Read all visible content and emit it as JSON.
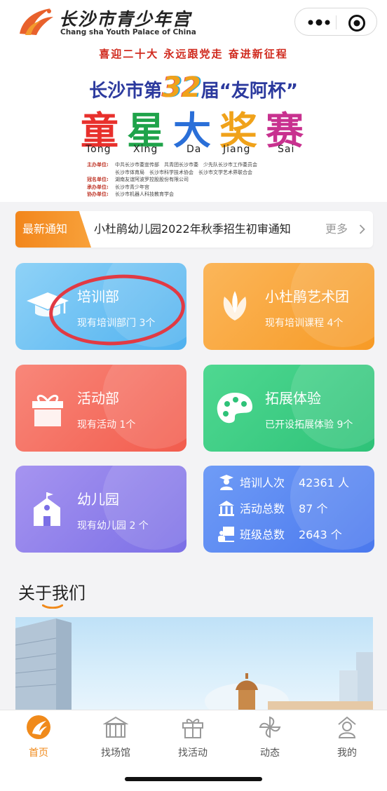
{
  "header": {
    "brand_cn": "长沙市青少年宫",
    "brand_en": "Chang sha Youth Palace of China"
  },
  "banner": {
    "slogan": "喜迎二十大 永远跟党走 奋进新征程",
    "subtitle_pre": "长沙市第",
    "subtitle_num": "32",
    "subtitle_post": "届“友阿杯”",
    "title_chars": [
      {
        "char": "童",
        "color": "#e8302c"
      },
      {
        "char": "星",
        "color": "#1fa34a"
      },
      {
        "char": "大",
        "color": "#2a6fd8"
      },
      {
        "char": "奖",
        "color": "#f0a21a"
      },
      {
        "char": "赛",
        "color": "#c8318f"
      }
    ],
    "pinyin": [
      "Tong",
      "Xing",
      "Da",
      "Jiang",
      "Sai"
    ],
    "orgs": [
      {
        "k": "主办单位:",
        "v": "中共长沙市委宣传部　共青团长沙市委　少先队长沙市工作委员会"
      },
      {
        "k": "",
        "v": "长沙市体育局　长沙市科学技术协会　长沙市文学艺术界联合会"
      },
      {
        "k": "冠名单位:",
        "v": "湖南友谊阿波罗控股股份有限公司"
      },
      {
        "k": "承办单位:",
        "v": "长沙市青少年宫"
      },
      {
        "k": "协办单位:",
        "v": "长沙市机器人科技教育学会"
      }
    ]
  },
  "notice": {
    "tag": "最新通知",
    "text": "小杜鹃幼儿园2022年秋季招生初审通知",
    "more": "更多"
  },
  "cards": [
    {
      "title": "培训部",
      "sub": "现有培训部门 3个",
      "icon": "graduation-cap-icon"
    },
    {
      "title": "小杜鹃艺术团",
      "sub": "现有培训课程 4个",
      "icon": "flower-icon"
    },
    {
      "title": "活动部",
      "sub": "现有活动 1个",
      "icon": "gift-icon"
    },
    {
      "title": "拓展体验",
      "sub": "已开设拓展体验 9个",
      "icon": "palette-icon"
    },
    {
      "title": "幼儿园",
      "sub": "现有幼儿园 2 个",
      "icon": "school-icon"
    }
  ],
  "stats": [
    {
      "label": "培训人次",
      "value": "42361 人",
      "icon": "graduate-person-icon"
    },
    {
      "label": "活动总数",
      "value": "87 个",
      "icon": "building-icon"
    },
    {
      "label": "班级总数",
      "value": "2643 个",
      "icon": "classroom-icon"
    }
  ],
  "about": {
    "title": "关于我们"
  },
  "tabs": [
    {
      "label": "首页",
      "icon": "home-logo-icon",
      "active": true
    },
    {
      "label": "找场馆",
      "icon": "venue-icon",
      "active": false
    },
    {
      "label": "找活动",
      "icon": "gift-box-icon",
      "active": false
    },
    {
      "label": "动态",
      "icon": "pinwheel-icon",
      "active": false
    },
    {
      "label": "我的",
      "icon": "user-icon",
      "active": false
    }
  ],
  "colors": {
    "accent": "#f08a1b",
    "annotation": "#e13a44"
  }
}
